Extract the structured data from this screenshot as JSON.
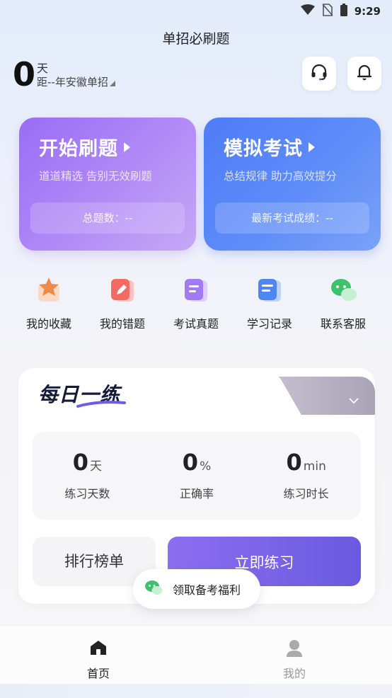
{
  "status_bar": {
    "time": "9:29",
    "icons": [
      "wifi-icon",
      "no-sim-icon",
      "battery-icon"
    ]
  },
  "header": {
    "title": "单招必刷题"
  },
  "countdown": {
    "days": "0",
    "unit": "天",
    "target": "距--年安徽单招"
  },
  "header_buttons": [
    {
      "icon": "headset-icon"
    },
    {
      "icon": "bell-icon"
    }
  ],
  "cards": {
    "practice": {
      "title": "开始刷题",
      "subtitle": "道道精选 告别无效刷题",
      "stat": "总题数：--"
    },
    "mock_exam": {
      "title": "模拟考试",
      "subtitle": "总结规律 助力高效提分",
      "stat": "最新考试成绩：--"
    }
  },
  "shortcuts": [
    {
      "label": "我的收藏",
      "icon": "star-icon"
    },
    {
      "label": "我的错题",
      "icon": "pen-icon"
    },
    {
      "label": "考试真题",
      "icon": "exam-paper-icon"
    },
    {
      "label": "学习记录",
      "icon": "record-icon"
    },
    {
      "label": "联系客服",
      "icon": "wechat-icon"
    }
  ],
  "daily": {
    "title": "每日一练",
    "stats": [
      {
        "value": "0",
        "unit": "天",
        "caption": "练习天数"
      },
      {
        "value": "0",
        "unit": "%",
        "caption": "正确率"
      },
      {
        "value": "0",
        "unit": "min",
        "caption": "练习时长"
      }
    ],
    "rank_label": "排行榜单",
    "practice_label": "立即练习"
  },
  "benefit": {
    "label": "领取备考福利"
  },
  "nav": {
    "home": "首页",
    "mine": "我的"
  },
  "colors": {
    "purple": "#9a6cf6",
    "blue": "#4f7cf7",
    "accent": "#6a5adf"
  }
}
